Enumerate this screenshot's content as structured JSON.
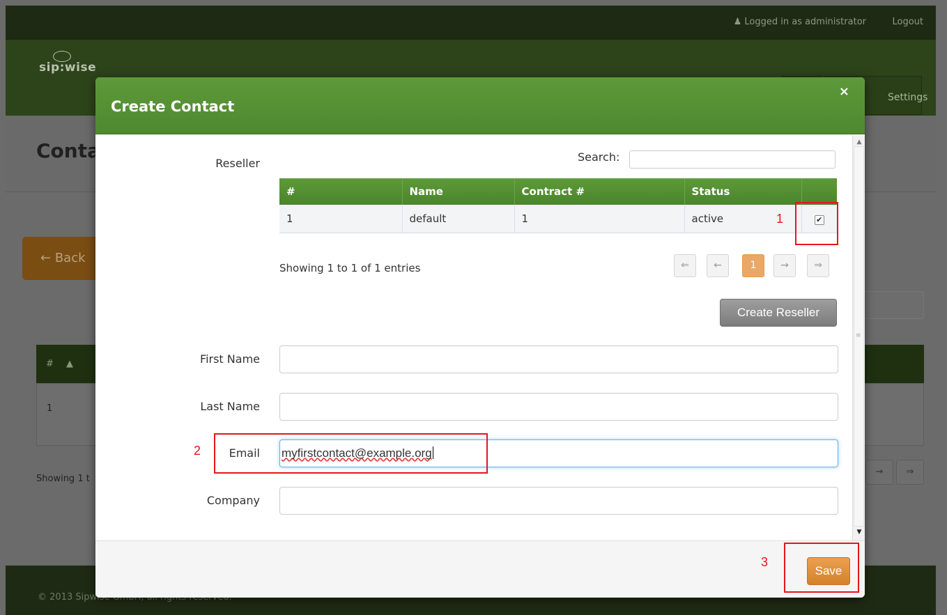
{
  "topbar": {
    "logged_in_text": "Logged in as administrator",
    "logout_label": "Logout"
  },
  "brand": {
    "logo_text": "sip:wise",
    "settings_label": "Settings"
  },
  "background_page": {
    "title": "Conta",
    "back_label": "Back",
    "table_header_hash": "#",
    "row_id": "1",
    "showing_text": "Showing 1 t",
    "footer_text": "© 2013 Sipwise GmbH, all rights reserved."
  },
  "modal": {
    "title": "Create Contact",
    "close_symbol": "×",
    "reseller_label": "Reseller",
    "search_label": "Search:",
    "search_value": "",
    "table": {
      "columns": [
        "#",
        "Name",
        "Contract #",
        "Status",
        ""
      ],
      "rows": [
        {
          "id": "1",
          "name": "default",
          "contract": "1",
          "status": "active",
          "selected": true
        }
      ]
    },
    "showing_text": "Showing 1 to 1 of 1 entries",
    "pager": {
      "first": "⇐",
      "prev": "←",
      "current": "1",
      "next": "→",
      "last": "⇒"
    },
    "create_reseller_label": "Create Reseller",
    "fields": {
      "first_name": {
        "label": "First Name",
        "value": ""
      },
      "last_name": {
        "label": "Last Name",
        "value": ""
      },
      "email": {
        "label": "Email",
        "value": "myfirstcontact@example.org"
      },
      "company": {
        "label": "Company",
        "value": ""
      }
    },
    "save_label": "Save"
  },
  "annotations": {
    "one": "1",
    "two": "2",
    "three": "3",
    "color": "#e8141c"
  },
  "colors": {
    "header_green": "#5d9a3a",
    "save_orange": "#e08f3a",
    "pager_active": "#e9a866"
  }
}
